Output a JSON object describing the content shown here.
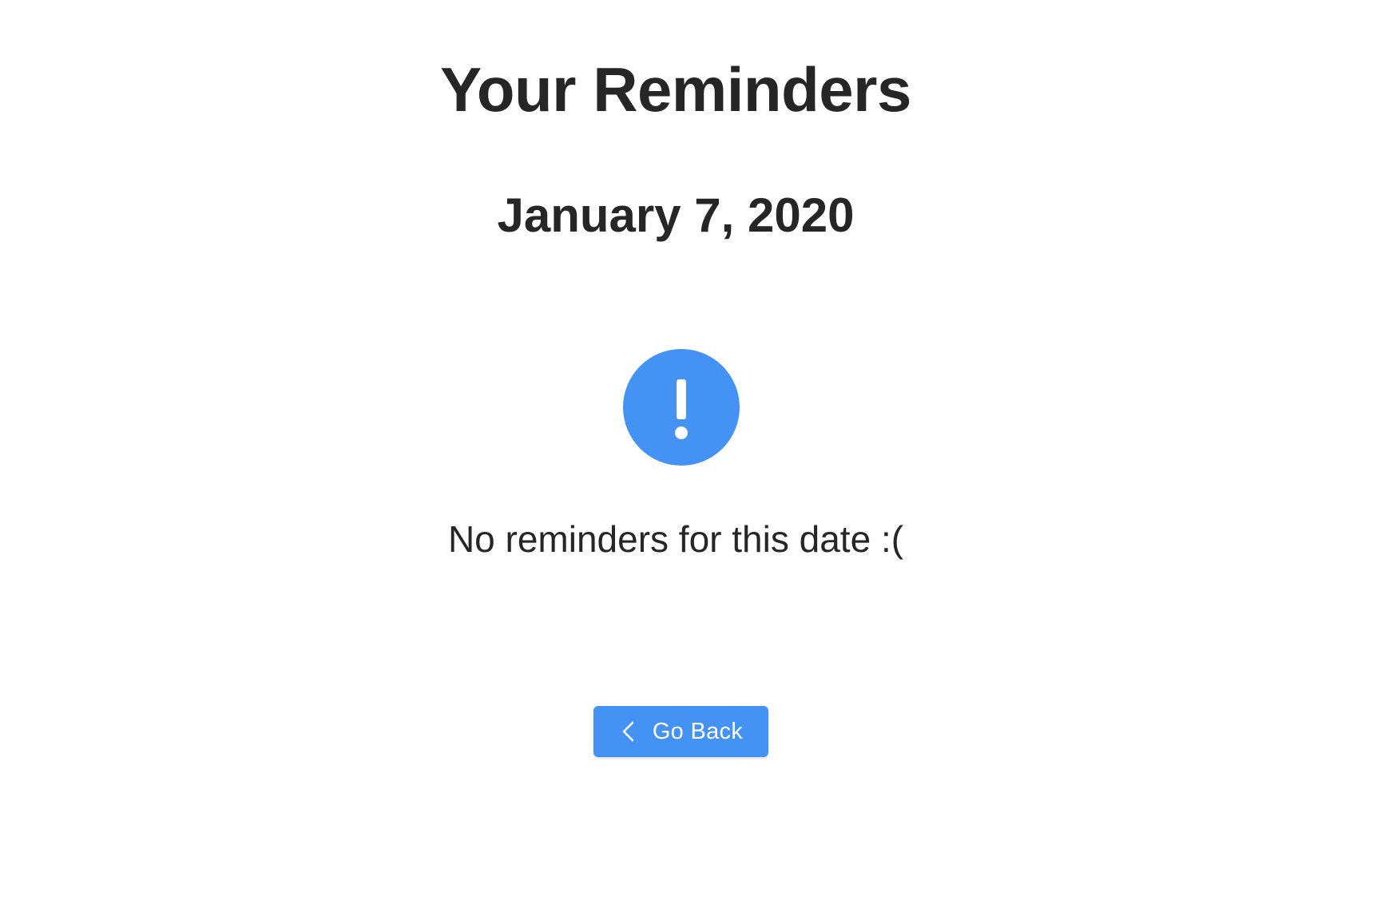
{
  "header": {
    "title": "Your Reminders",
    "date": "January 7, 2020"
  },
  "empty_state": {
    "icon": "exclamation-circle-icon",
    "message": "No reminders for this date :("
  },
  "actions": {
    "back_icon": "chevron-left-icon",
    "back_label": "Go Back"
  },
  "colors": {
    "accent": "#4492f3",
    "text": "#262626",
    "background": "#ffffff"
  }
}
